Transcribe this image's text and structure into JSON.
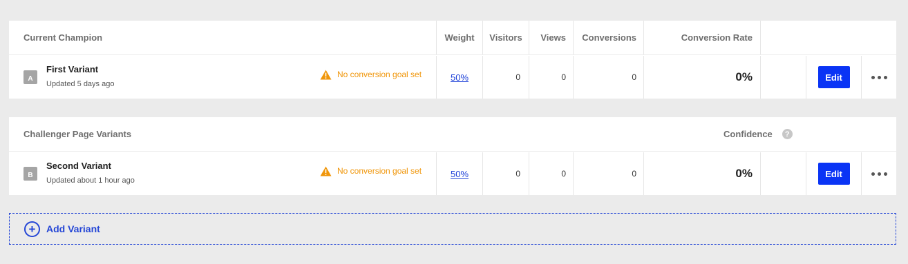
{
  "champion": {
    "section_title": "Current Champion",
    "columns": {
      "weight": "Weight",
      "visitors": "Visitors",
      "views": "Views",
      "conversions": "Conversions",
      "conversion_rate": "Conversion Rate"
    },
    "variant": {
      "badge": "A",
      "name": "First Variant",
      "updated": "Updated 5 days ago",
      "warning": "No conversion goal set",
      "weight": "50%",
      "visitors": "0",
      "views": "0",
      "conversions": "0",
      "conversion_rate": "0%",
      "edit_label": "Edit"
    }
  },
  "challenger": {
    "section_title": "Challenger Page Variants",
    "confidence_label": "Confidence",
    "help_glyph": "?",
    "variant": {
      "badge": "B",
      "name": "Second Variant",
      "updated": "Updated about 1 hour ago",
      "warning": "No conversion goal set",
      "weight": "50%",
      "visitors": "0",
      "views": "0",
      "conversions": "0",
      "conversion_rate": "0%",
      "edit_label": "Edit"
    }
  },
  "add_variant": {
    "label": "Add Variant",
    "icon": "plus-circle-icon",
    "glyph": "+"
  },
  "colors": {
    "accent": "#0a34f5",
    "warning": "#f0960a",
    "link": "#2043d9",
    "background": "#ebebeb"
  }
}
